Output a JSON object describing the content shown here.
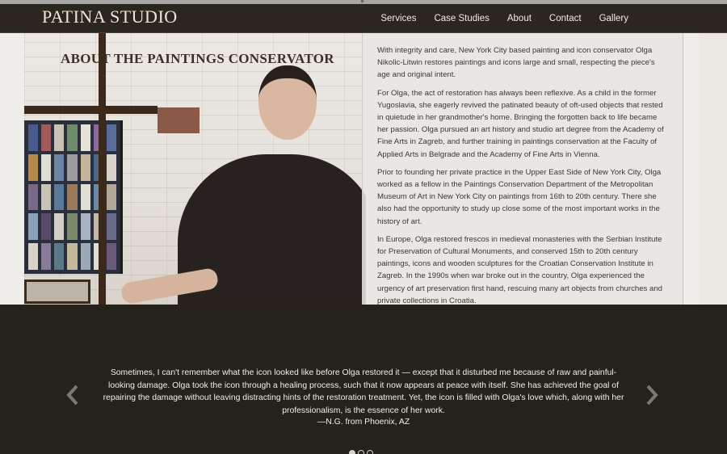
{
  "header": {
    "logo": "PATINA STUDIO",
    "nav": [
      "Services",
      "Case Studies",
      "About",
      "Contact",
      "Gallery"
    ]
  },
  "hero": {
    "title": "ABOUT THE PAINTINGS CONSERVATOR",
    "paragraphs": [
      "With integrity and care, New York City based painting and icon conservator Olga Nikolic-Litwin restores paintings and icons large and small, respecting the piece's age and original intent.",
      "For Olga, the act of restoration has always been reflexive. As a child in the former Yugoslavia, she eagerly revived the patinated beauty of oft-used objects that rested in quietude in her grandmother's home. Bringing the forgotten back to life became her passion. Olga pursued an art history and studio art degree from the Academy of Fine Arts in Zagreb, and further training in paintings conservation at the Faculty of Applied Arts in Belgrade and the Academy of Fine Arts in Vienna.",
      "Prior to founding her private practice in the Upper East Side of New York City, Olga worked as a fellow in the Paintings Conservation Department of the Metropolitan Museum of Art in New York City on paintings from 16th to 20th century. There she also had the opportunity to study up close some of the most important works in the history of art.",
      "In Europe, Olga restored frescos in medieval monasteries with the Serbian Institute for Preservation of Cultural Monuments, and conserved 15th to 20th century paintings, icons and wooden sculptures for the Croatian Conservation Institute in Zagreb. In the 1990s when war broke out in the country, Olga experienced the urgency of art preservation first hand, rescuing many art objects from churches and private collections in Croatia."
    ]
  },
  "testimonial": {
    "quote": "Sometimes, I can't remember what the icon looked like before Olga restored it — except that it disturbed me because of raw and painful-looking damage. Olga took the icon through a healing process, such that it now appears at peace with itself. She has achieved the goal of repairing the damage without leaving distracting hints of the restoration treatment. Yet, the icon is filled with Olga's love which, along with her professionalism, is the essence of her work.",
    "author": "—N.G. from Phoenix, AZ",
    "prev_icon": "chevron-left-icon",
    "next_icon": "chevron-right-icon",
    "dots": 3,
    "active_dot": 0
  },
  "colors": {
    "header_bg": "#2c2620",
    "footer_bg": "#25211b",
    "text": "#3c3731"
  }
}
